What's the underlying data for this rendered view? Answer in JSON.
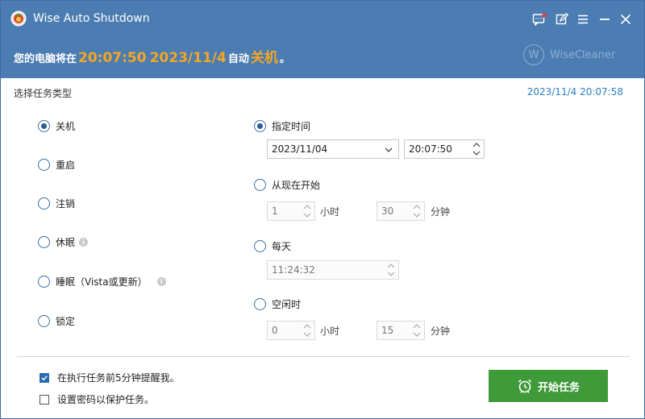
{
  "app": {
    "title": "Wise Auto Shutdown",
    "brand": "WiseCleaner",
    "brand_mark": "W"
  },
  "titlebar_icons": [
    "message-icon",
    "edit-icon",
    "menu-icon",
    "minimize-icon",
    "close-icon"
  ],
  "status": {
    "prefix": "您的电脑将在",
    "time": "20:07:50",
    "date": "2023/11/4",
    "mid": "自动",
    "action": "关机",
    "suffix": "。"
  },
  "section_label": "选择任务类型",
  "current_clock": "2023/11/4 20:07:58",
  "task_types": [
    {
      "label": "关机",
      "checked": true
    },
    {
      "label": "重启",
      "checked": false
    },
    {
      "label": "注销",
      "checked": false
    },
    {
      "label": "休眠",
      "checked": false
    },
    {
      "label": "睡眠（Vista或更新）",
      "checked": false
    },
    {
      "label": "锁定",
      "checked": false
    }
  ],
  "schedule": {
    "specified": {
      "label": "指定时间",
      "checked": true,
      "date": "2023/11/04",
      "time": "20:07:50"
    },
    "from_now": {
      "label": "从现在开始",
      "checked": false,
      "hours": "1",
      "hours_unit": "小时",
      "minutes": "30",
      "minutes_unit": "分钟"
    },
    "daily": {
      "label": "每天",
      "checked": false,
      "time": "11:24:32"
    },
    "idle": {
      "label": "空闲时",
      "checked": false,
      "hours": "0",
      "hours_unit": "小时",
      "minutes": "15",
      "minutes_unit": "分钟"
    }
  },
  "options": {
    "remind": {
      "label": "在执行任务前5分钟提醒我。",
      "checked": true
    },
    "password": {
      "label": "设置密码以保护任务。",
      "checked": false
    }
  },
  "start_button": "开始任务",
  "colors": {
    "header": "#4b7cb2",
    "highlight": "#f5a623",
    "clock": "#2a7fbf",
    "start_button": "#3f9a3a"
  }
}
